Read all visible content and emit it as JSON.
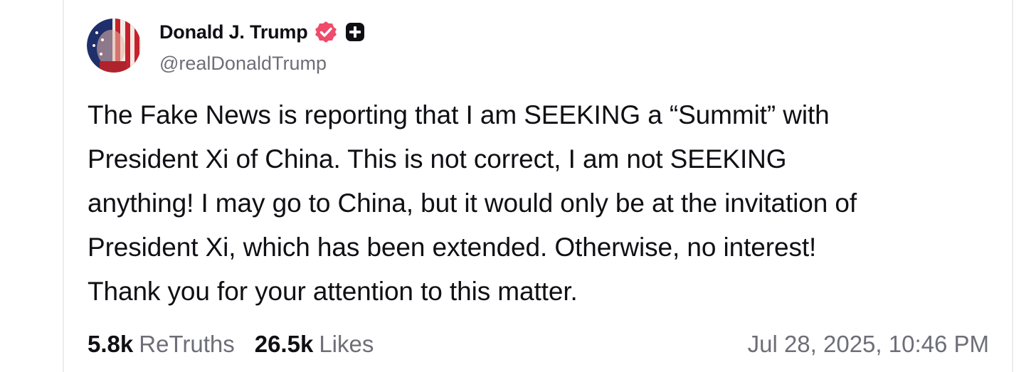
{
  "post": {
    "author": {
      "display_name": "Donald J. Trump",
      "handle": "@realDonaldTrump",
      "verified_color": "#ef4b6b"
    },
    "text_lines": [
      "The Fake News is reporting that I am SEEKING a “Summit” with",
      "President Xi of China. This is not correct, I am not SEEKING",
      "anything! I may go to China, but it would only be at the invitation of",
      "President Xi, which has been extended. Otherwise, no interest!",
      "Thank you for your attention to this matter."
    ],
    "stats": {
      "retruths_count": "5.8k",
      "retruths_label": "ReTruths",
      "likes_count": "26.5k",
      "likes_label": "Likes"
    },
    "timestamp": "Jul 28, 2025, 10:46 PM"
  }
}
